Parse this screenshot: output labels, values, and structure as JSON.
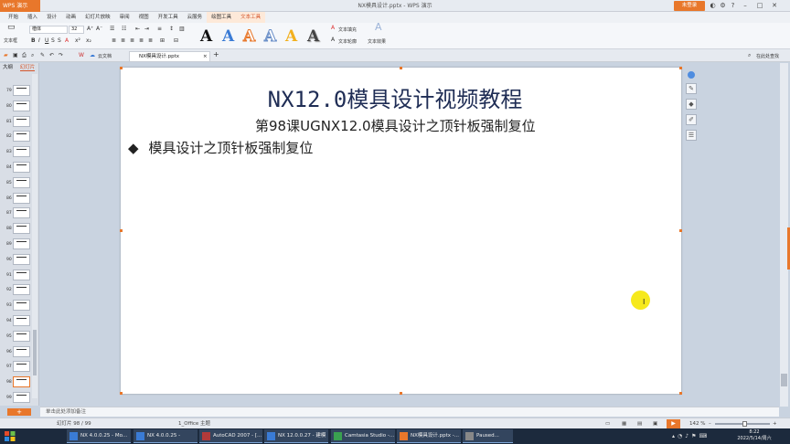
{
  "window": {
    "app_button": "WPS 演示",
    "doc_title": "NX模具设计.pptx - WPS 演示",
    "login_button": "未登录"
  },
  "menu": {
    "tabs": [
      "开始",
      "插入",
      "设计",
      "动画",
      "幻灯片放映",
      "审阅",
      "视图",
      "开发工具",
      "云服务",
      "绘图工具",
      "文本工具"
    ],
    "active": "文本工具"
  },
  "ribbon": {
    "text_box_label": "文本框",
    "font_name": "楷体",
    "font_size": "32",
    "text_fill_label": "文本填充",
    "text_outline_label": "文本轮廓",
    "text_effect_label": "文本效果",
    "style_glyph": "A"
  },
  "quick_access": {
    "cloud_doc": "云文档"
  },
  "doc_tabs": [
    {
      "label": "NX模具设计.pptx"
    }
  ],
  "search_box": "在此处查找",
  "left_panel": {
    "tab_outline": "大纲",
    "tab_slides": "幻灯片",
    "thumbnails": [
      "79",
      "80",
      "81",
      "82",
      "83",
      "84",
      "85",
      "86",
      "87",
      "88",
      "89",
      "90",
      "91",
      "92",
      "93",
      "94",
      "95",
      "96",
      "97",
      "98",
      "99"
    ],
    "selected": "98",
    "add_label": "+"
  },
  "slide": {
    "title": "NX12.0模具设计视频教程",
    "subtitle": "第98课UGNX12.0模具设计之顶针板强制复位",
    "bullet_mark": "◆",
    "bullet": "模具设计之顶针板强制复位"
  },
  "notes_placeholder": "单击此处添加备注",
  "status": {
    "slide_counter": "幻灯片 98 / 99",
    "theme": "1_Office 主题",
    "zoom": "142 %"
  },
  "taskbar": {
    "items": [
      {
        "label": "NX 4.0.0.25 - Mo...",
        "color": "#3a7bd5"
      },
      {
        "label": "NX 4.0.0.25 -",
        "color": "#3a7bd5"
      },
      {
        "label": "AutoCAD 2007 - [...",
        "color": "#b23a3a"
      },
      {
        "label": "NX 12.0.0.27 - 建模",
        "color": "#3a7bd5"
      },
      {
        "label": "Camtasia Studio -...",
        "color": "#3aa050"
      },
      {
        "label": "NX模具设计.pptx -...",
        "color": "#e8772b"
      },
      {
        "label": "Paused...",
        "color": "#888888"
      }
    ],
    "time": "8:22",
    "date": "2022/5/14/周六"
  },
  "colors": {
    "accent": "#e8772b",
    "title_text": "#1f2d55"
  }
}
